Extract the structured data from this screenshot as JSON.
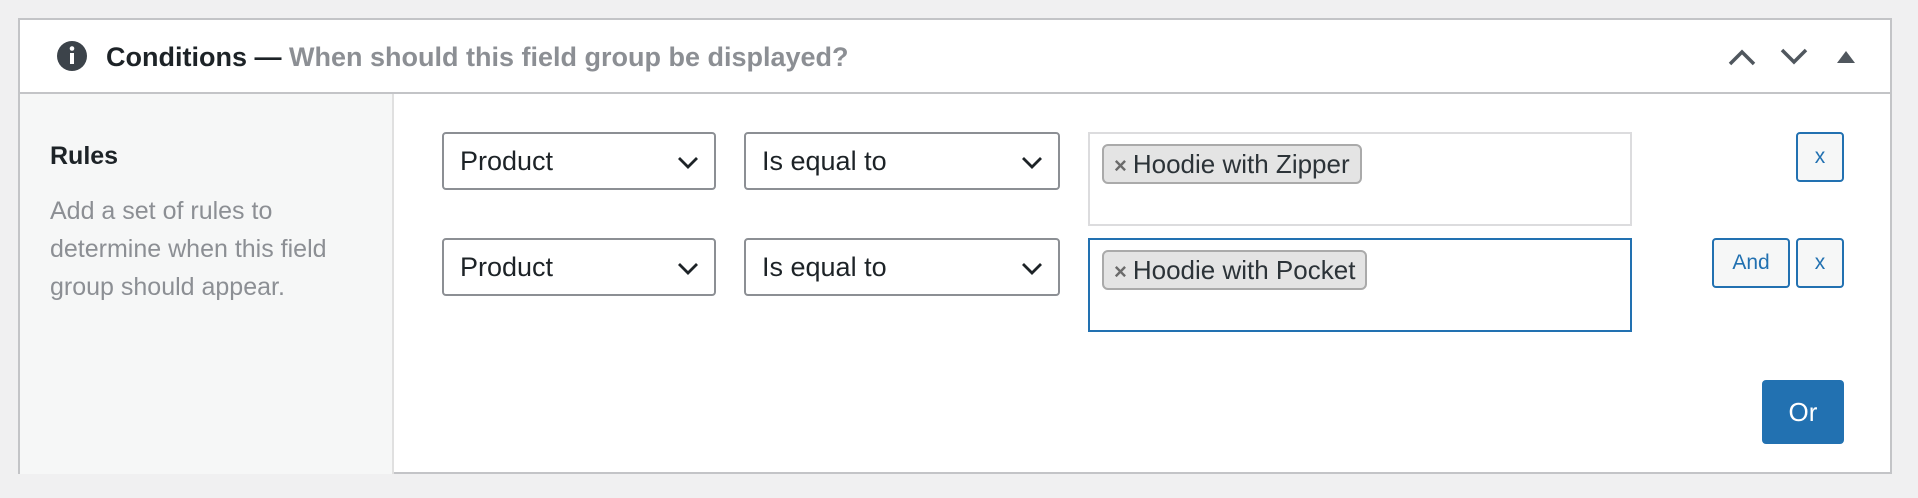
{
  "header": {
    "title": "Conditions —",
    "subtitle": "When should this field group be displayed?",
    "icons": {
      "info": "info-icon",
      "move_up": "chevron-up-icon",
      "move_down": "chevron-down-icon",
      "toggle": "triangle-up-icon"
    }
  },
  "sidebar": {
    "title": "Rules",
    "description": "Add a set of rules to determine when this field group should appear."
  },
  "rules": [
    {
      "param": "Product",
      "operator": "Is equal to",
      "value_tag": "Hoodie with Zipper",
      "tag_remove": "×",
      "remove_label": "x"
    },
    {
      "param": "Product",
      "operator": "Is equal to",
      "value_tag": "Hoodie with Pocket",
      "tag_remove": "×",
      "and_label": "And",
      "remove_label": "x"
    }
  ],
  "or_button": "Or",
  "colors": {
    "accent": "#2271b1",
    "muted_text": "#8c8f94",
    "text": "#1d2327",
    "border": "#c3c4c7"
  }
}
